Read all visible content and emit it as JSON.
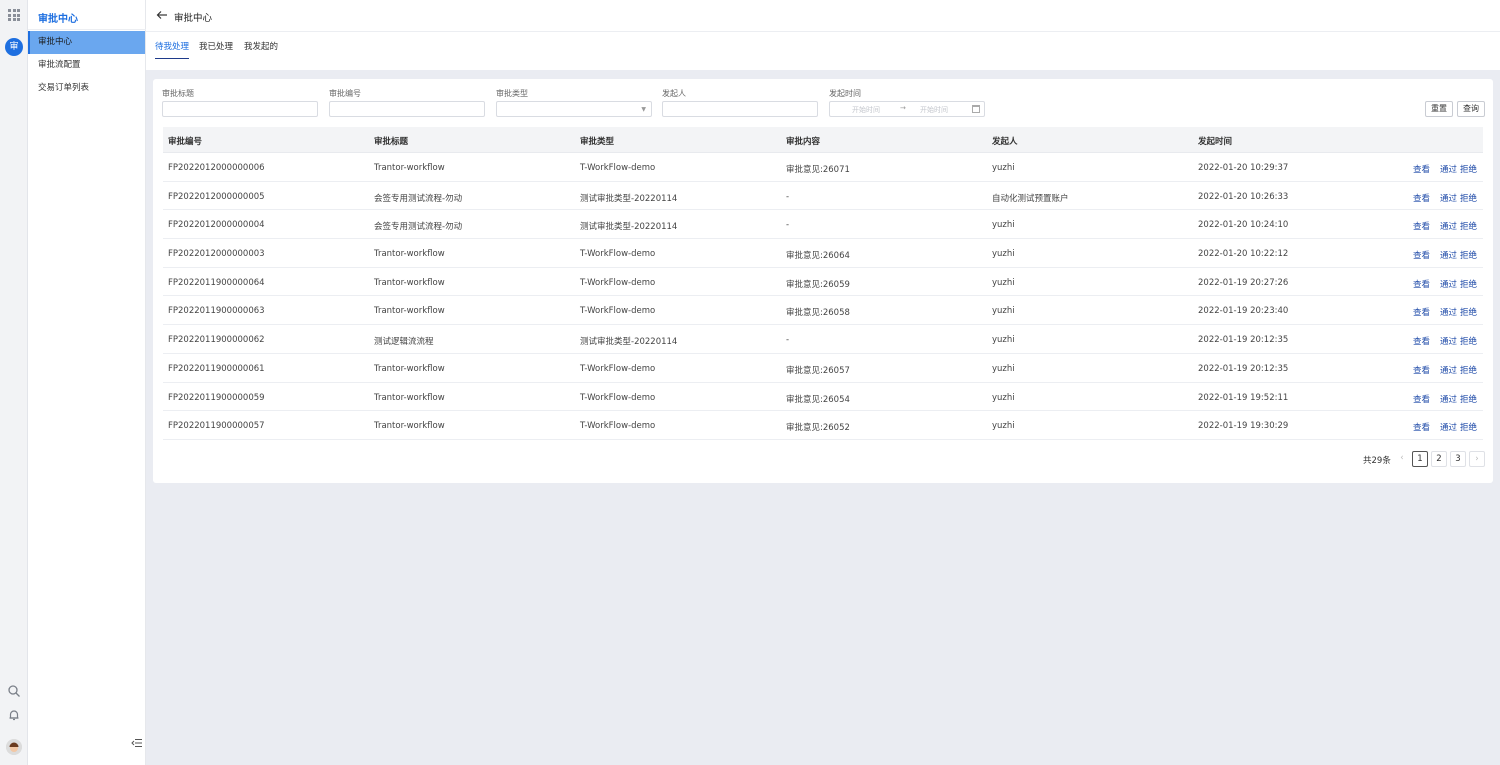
{
  "app": {
    "brand": "审批中心",
    "app_badge": "审"
  },
  "sidebar": {
    "items": [
      {
        "label": "审批中心",
        "active": true
      },
      {
        "label": "审批流配置",
        "active": false
      },
      {
        "label": "交易订单列表",
        "active": false
      }
    ]
  },
  "header": {
    "title": "审批中心"
  },
  "tabs": [
    {
      "label": "待我处理",
      "active": true
    },
    {
      "label": "我已处理",
      "active": false
    },
    {
      "label": "我发起的",
      "active": false
    }
  ],
  "filters": {
    "title_label": "审批标题",
    "number_label": "审批编号",
    "type_label": "审批类型",
    "initiator_label": "发起人",
    "time_label": "发起时间",
    "start_placeholder": "开始时间",
    "end_placeholder": "开始时间"
  },
  "buttons": {
    "reset": "重置",
    "query": "查询"
  },
  "table": {
    "columns": [
      "审批编号",
      "审批标题",
      "审批类型",
      "审批内容",
      "发起人",
      "发起时间"
    ],
    "actions": {
      "view": "查看",
      "approve": "通过",
      "reject": "拒绝"
    },
    "rows": [
      [
        "FP2022012000000006",
        "Trantor-workflow",
        "T-WorkFlow-demo",
        "审批意见:26071",
        "yuzhi",
        "2022-01-20 10:29:37"
      ],
      [
        "FP2022012000000005",
        "会签专用测试流程-勿动",
        "测试审批类型-20220114",
        "-",
        "自动化测试预置账户",
        "2022-01-20 10:26:33"
      ],
      [
        "FP2022012000000004",
        "会签专用测试流程-勿动",
        "测试审批类型-20220114",
        "-",
        "yuzhi",
        "2022-01-20 10:24:10"
      ],
      [
        "FP2022012000000003",
        "Trantor-workflow",
        "T-WorkFlow-demo",
        "审批意见:26064",
        "yuzhi",
        "2022-01-20 10:22:12"
      ],
      [
        "FP2022011900000064",
        "Trantor-workflow",
        "T-WorkFlow-demo",
        "审批意见:26059",
        "yuzhi",
        "2022-01-19 20:27:26"
      ],
      [
        "FP2022011900000063",
        "Trantor-workflow",
        "T-WorkFlow-demo",
        "审批意见:26058",
        "yuzhi",
        "2022-01-19 20:23:40"
      ],
      [
        "FP2022011900000062",
        "测试逻辑流流程",
        "测试审批类型-20220114",
        "-",
        "yuzhi",
        "2022-01-19 20:12:35"
      ],
      [
        "FP2022011900000061",
        "Trantor-workflow",
        "T-WorkFlow-demo",
        "审批意见:26057",
        "yuzhi",
        "2022-01-19 20:12:35"
      ],
      [
        "FP2022011900000059",
        "Trantor-workflow",
        "T-WorkFlow-demo",
        "审批意见:26054",
        "yuzhi",
        "2022-01-19 19:52:11"
      ],
      [
        "FP2022011900000057",
        "Trantor-workflow",
        "T-WorkFlow-demo",
        "审批意见:26052",
        "yuzhi",
        "2022-01-19 19:30:29"
      ]
    ]
  },
  "pagination": {
    "total": "共29条",
    "pages": [
      "1",
      "2",
      "3"
    ],
    "current": "1",
    "prev": "‹",
    "next": "›"
  },
  "colors": {
    "accent": "#1e6fe0",
    "active_item": "#6aa7ef",
    "link": "#1e4aa8"
  }
}
